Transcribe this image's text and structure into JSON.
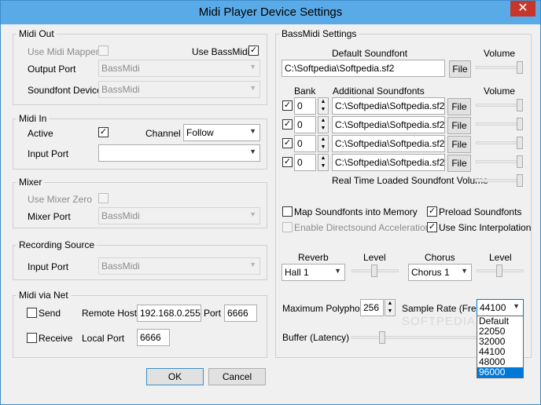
{
  "window": {
    "title": "Midi Player Device Settings",
    "close_glyph": "✕"
  },
  "midi_out": {
    "title": "Midi Out",
    "use_midi_mapper": "Use Midi Mapper",
    "use_bassmidi": "Use BassMidi",
    "output_port_label": "Output Port",
    "output_port_value": "BassMidi",
    "soundfont_device_label": "Soundfont Device",
    "soundfont_device_value": "BassMidi"
  },
  "midi_in": {
    "title": "Midi In",
    "active": "Active",
    "channel_label": "Channel",
    "channel_value": "Follow",
    "input_port_label": "Input Port",
    "input_port_value": ""
  },
  "mixer": {
    "title": "Mixer",
    "use_mixer_zero": "Use Mixer Zero",
    "mixer_port_label": "Mixer Port",
    "mixer_port_value": "BassMidi"
  },
  "recording": {
    "title": "Recording Source",
    "input_port_label": "Input Port",
    "input_port_value": "BassMidi"
  },
  "midi_net": {
    "title": "Midi via Net",
    "send": "Send",
    "receive": "Receive",
    "remote_host_label": "Remote Host",
    "remote_host_value": "192.168.0.255",
    "port_label": "Port",
    "port_value": "6666",
    "local_port_label": "Local Port",
    "local_port_value": "6666"
  },
  "bassmidi": {
    "title": "BassMidi Settings",
    "default_soundfont_label": "Default Soundfont",
    "volume_label": "Volume",
    "default_soundfont_value": "C:\\Softpedia\\Softpedia.sf2",
    "file_button": "File",
    "bank_label": "Bank",
    "additional_label": "Additional Soundfonts",
    "volume_label2": "Volume",
    "rows": [
      {
        "bank": "0",
        "path": "C:\\Softpedia\\Softpedia.sf2",
        "file": "File"
      },
      {
        "bank": "0",
        "path": "C:\\Softpedia\\Softpedia.sf2",
        "file": "File"
      },
      {
        "bank": "0",
        "path": "C:\\Softpedia\\Softpedia.sf2",
        "file": "File"
      },
      {
        "bank": "0",
        "path": "C:\\Softpedia\\Softpedia.sf2",
        "file": "File"
      }
    ],
    "realtime_volume_label": "Real Time Loaded Soundfont Volume",
    "map_memory": "Map Soundfonts into Memory",
    "preload": "Preload Soundfonts",
    "directsound": "Enable Directsound Acceleration",
    "sinc": "Use Sinc Interpolation",
    "reverb_label": "Reverb",
    "reverb_level_label": "Level",
    "chorus_label": "Chorus",
    "chorus_level_label": "Level",
    "reverb_value": "Hall 1",
    "chorus_value": "Chorus 1",
    "polyphony_label": "Maximum Polyphony",
    "polyphony_value": "256",
    "sample_rate_label": "Sample Rate (Freq)",
    "sample_rate_value": "44100",
    "sample_rate_options": [
      "Default",
      "22050",
      "32000",
      "44100",
      "48000",
      "96000"
    ],
    "buffer_label": "Buffer (Latency)"
  },
  "buttons": {
    "ok": "OK",
    "cancel": "Cancel"
  },
  "watermark": "SOFTPEDIA",
  "colors": {
    "titlebar": "#5aaae8",
    "close": "#c7362b",
    "selection": "#0078d7"
  }
}
